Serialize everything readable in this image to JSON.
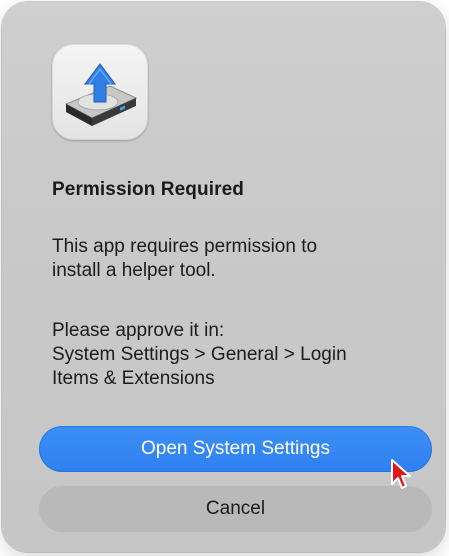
{
  "dialog": {
    "title": "Permission Required",
    "message_line_1": "This app requires permission to",
    "message_line_2": "install a helper tool.",
    "instructions_line_1": "Please approve it in:",
    "instructions_line_2": "System Settings > General > Login",
    "instructions_line_3": "Items & Extensions",
    "icon": "disk-utility-install-icon"
  },
  "buttons": {
    "primary_label": "Open System Settings",
    "secondary_label": "Cancel"
  },
  "colors": {
    "dialog_bg": "#c9c9c9",
    "primary_button": "#3286f4",
    "secondary_button": "#b9b9b9",
    "cursor": "#e0191d"
  },
  "cursor": {
    "icon": "mouse-pointer-icon"
  }
}
